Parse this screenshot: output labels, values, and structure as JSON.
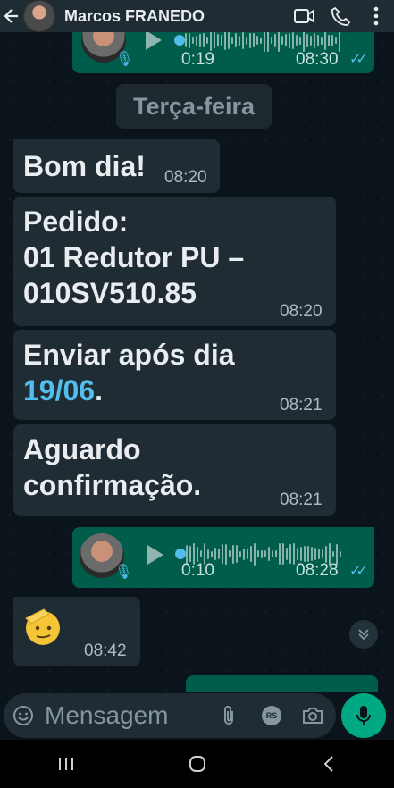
{
  "header": {
    "back_icon": "back-arrow-icon",
    "contact_name": "Marcos FRANEDO",
    "icons": [
      "video-call-icon",
      "voice-call-icon",
      "more-vert-icon"
    ]
  },
  "day_chip": "Terça-feira",
  "messages": [
    {
      "type": "voice",
      "direction": "outgoing",
      "duration": "0:19",
      "time": "08:30",
      "status": "read"
    },
    {
      "type": "text",
      "direction": "incoming",
      "text": "Bom dia!",
      "time": "08:20"
    },
    {
      "type": "text",
      "direction": "incoming",
      "text": "Pedido:\n01 Redutor PU –\n010SV510.85",
      "time": "08:20"
    },
    {
      "type": "text",
      "direction": "incoming",
      "text_before": "Enviar após dia\n",
      "link": "19/06",
      "text_after": ".",
      "time": "08:21"
    },
    {
      "type": "text",
      "direction": "incoming",
      "text": "Aguardo\nconfirmação.",
      "time": "08:21"
    },
    {
      "type": "voice",
      "direction": "outgoing",
      "duration": "0:10",
      "time": "08:28",
      "status": "read"
    },
    {
      "type": "emoji",
      "direction": "incoming",
      "emoji": "🫡",
      "time": "08:42"
    }
  ],
  "input": {
    "placeholder": "Mensagem",
    "emoji_icon": "emoji-icon",
    "attach_icon": "attach-icon",
    "rs_label": "RS",
    "camera_icon": "camera-icon",
    "mic_icon": "mic-icon"
  },
  "navbar": [
    "recent-apps-icon",
    "home-icon",
    "back-icon"
  ],
  "colors": {
    "background": "#0b141a",
    "header": "#1f2c34",
    "incoming_bubble": "#202c33",
    "outgoing_bubble": "#005c4b",
    "accent": "#00a884",
    "link": "#53bdeb"
  }
}
